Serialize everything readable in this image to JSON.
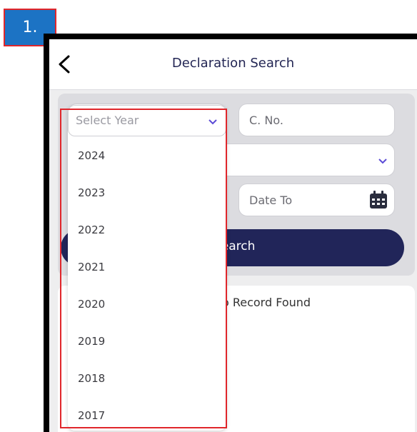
{
  "step_badge": "1.",
  "appbar": {
    "title": "Declaration Search"
  },
  "form": {
    "cno_placeholder": "C. No.",
    "date_to_placeholder": "Date To",
    "search_label": "Search"
  },
  "results": {
    "message": "No Record Found"
  },
  "year_dropdown": {
    "placeholder": "Select Year",
    "options": [
      "2024",
      "2023",
      "2022",
      "2021",
      "2020",
      "2019",
      "2018",
      "2017"
    ]
  },
  "colors": {
    "accent": "#212559",
    "highlight": "#e0262b",
    "badge": "#1c73c4",
    "chevron": "#5b4bd6"
  }
}
